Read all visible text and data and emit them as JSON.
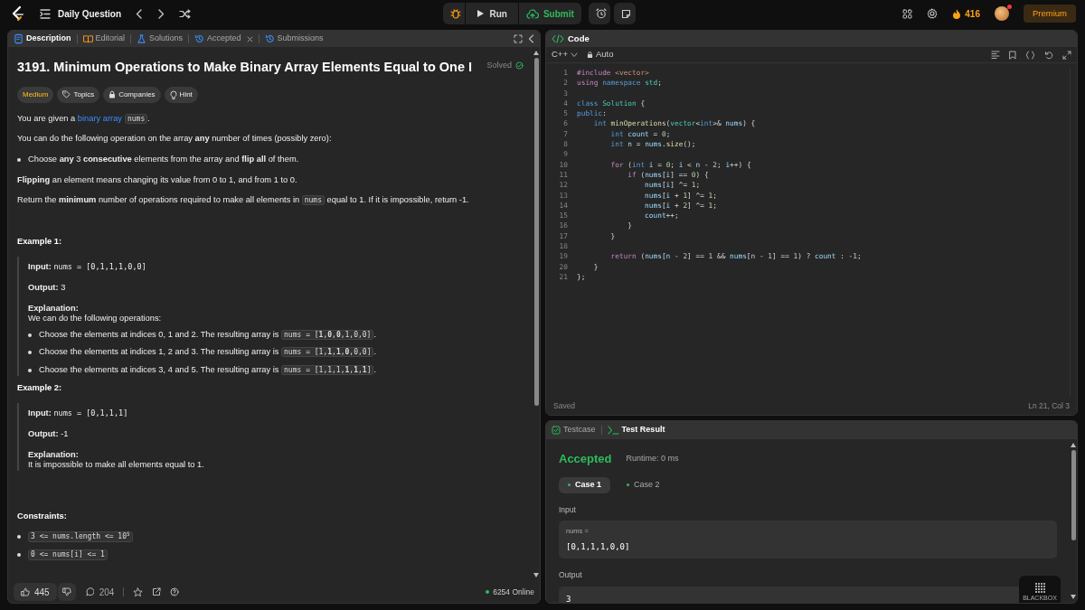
{
  "topbar": {
    "title": "Daily Question",
    "run": "Run",
    "submit": "Submit",
    "streak": "416",
    "premium": "Premium",
    "notification": true
  },
  "description_tabs": [
    {
      "label": "Description",
      "selected": true,
      "closable": false
    },
    {
      "label": "Editorial",
      "selected": false,
      "closable": false
    },
    {
      "label": "Solutions",
      "selected": false,
      "closable": false
    },
    {
      "label": "Accepted",
      "selected": false,
      "closable": true
    },
    {
      "label": "Submissions",
      "selected": false,
      "closable": false
    }
  ],
  "problem": {
    "title": "3191. Minimum Operations to Make Binary Array Elements Equal to One I",
    "status": "Solved",
    "tags": [
      {
        "label": "Medium",
        "kind": "difficulty"
      },
      {
        "label": "Topics",
        "kind": "topics"
      },
      {
        "label": "Companies",
        "kind": "companies"
      },
      {
        "label": "Hint",
        "kind": "hint"
      }
    ],
    "blocks": [
      {
        "kind": "para",
        "segments": [
          {
            "kind": "text",
            "text": "You are given a "
          },
          {
            "kind": "link",
            "text": "binary array"
          },
          {
            "kind": "code",
            "text": "nums"
          },
          {
            "kind": "text",
            "text": "."
          }
        ]
      },
      {
        "kind": "para",
        "segments": [
          {
            "kind": "text",
            "text": "You can do the following operation on the array **any** number of times (possibly zero):"
          }
        ]
      },
      {
        "kind": "bullet",
        "segments": [
          {
            "kind": "text",
            "text": "Choose **any** 3 **consecutive** elements from the array and **flip all** of them."
          }
        ]
      },
      {
        "kind": "para",
        "segments": [
          {
            "kind": "text",
            "text": "**Flipping** an element means changing its value from 0 to 1, and from 1 to 0."
          }
        ]
      },
      {
        "kind": "para",
        "segments": [
          {
            "kind": "text",
            "text": "Return the **minimum** number of operations required to make all elements in "
          },
          {
            "kind": "code",
            "text": "nums"
          },
          {
            "kind": "text",
            "text": " equal to 1. If it is impossible, return -1."
          }
        ]
      }
    ],
    "examples": [
      {
        "title": "Example 1:",
        "input_label": "Input:",
        "input": "nums = [0,1,1,1,0,0]",
        "output_label": "Output:",
        "output": "3",
        "explanation_label": "Explanation:",
        "explanation": "We can do the following operations:",
        "steps": [
          [
            {
              "kind": "text",
              "text": "Choose the elements at indices 0, 1 and 2. The resulting array is "
            },
            {
              "kind": "code",
              "text": "nums = [**1**,**0**,**0**,1,0,0]"
            },
            {
              "kind": "text",
              "text": "."
            }
          ],
          [
            {
              "kind": "text",
              "text": "Choose the elements at indices 1, 2 and 3. The resulting array is "
            },
            {
              "kind": "code",
              "text": "nums = [1,**1**,**1**,**0**,0,0]"
            },
            {
              "kind": "text",
              "text": "."
            }
          ],
          [
            {
              "kind": "text",
              "text": "Choose the elements at indices 3, 4 and 5. The resulting array is "
            },
            {
              "kind": "code",
              "text": "nums = [1,1,1,**1**,**1**,**1**]"
            },
            {
              "kind": "text",
              "text": "."
            }
          ]
        ]
      },
      {
        "title": "Example 2:",
        "input_label": "Input:",
        "input": "nums = [0,1,1,1]",
        "output_label": "Output:",
        "output": "-1",
        "explanation_label": "Explanation:",
        "explanation": "It is impossible to make all elements equal to 1."
      }
    ],
    "constraints_title": "Constraints:",
    "constraints": [
      "3 <= nums.length <= 10$^{5}$",
      "0 <= nums[i] <= 1"
    ]
  },
  "footer": {
    "likes": "445",
    "comments": "204",
    "online": "6254 Online"
  },
  "code_panel": {
    "title": "Code",
    "language": "C++",
    "mode": "Auto",
    "status": "Saved",
    "cursor": "Ln 21, Col 3",
    "lines": [
      {
        "number": "1",
        "tokens": [
          {
            "kind": "pp",
            "text": "#include "
          },
          {
            "kind": "str",
            "text": "<vector>"
          }
        ]
      },
      {
        "number": "2",
        "tokens": [
          {
            "kind": "kw",
            "text": "using "
          },
          {
            "kind": "ty",
            "text": "namespace "
          },
          {
            "kind": "cls",
            "text": "std"
          },
          {
            "kind": "p",
            "text": ";"
          }
        ]
      },
      {
        "number": "3"
      },
      {
        "number": "4",
        "tokens": [
          {
            "kind": "ty",
            "text": "class "
          },
          {
            "kind": "cls",
            "text": "Solution"
          },
          {
            "kind": "p",
            "text": " {"
          }
        ]
      },
      {
        "number": "5",
        "tokens": [
          {
            "kind": "ty",
            "text": "public"
          },
          {
            "kind": "p",
            "text": ":"
          }
        ]
      },
      {
        "number": "6",
        "tokens": [
          {
            "kind": "ty",
            "text": "    int "
          },
          {
            "kind": "fn",
            "text": "minOperations"
          },
          {
            "kind": "p",
            "text": "("
          },
          {
            "kind": "cls",
            "text": "vector"
          },
          {
            "kind": "p",
            "text": "<"
          },
          {
            "kind": "ty",
            "text": "int"
          },
          {
            "kind": "p",
            "text": ">& "
          },
          {
            "kind": "var",
            "text": "nums"
          },
          {
            "kind": "p",
            "text": ") {"
          }
        ]
      },
      {
        "number": "7",
        "tokens": [
          {
            "kind": "ty",
            "text": "        int "
          },
          {
            "kind": "var",
            "text": "count"
          },
          {
            "kind": "p",
            "text": " = "
          },
          {
            "kind": "num",
            "text": "0"
          },
          {
            "kind": "p",
            "text": ";"
          }
        ]
      },
      {
        "number": "8",
        "tokens": [
          {
            "kind": "ty",
            "text": "        int "
          },
          {
            "kind": "var",
            "text": "n"
          },
          {
            "kind": "p",
            "text": " = "
          },
          {
            "kind": "var",
            "text": "nums"
          },
          {
            "kind": "p",
            "text": "."
          },
          {
            "kind": "fn",
            "text": "size"
          },
          {
            "kind": "p",
            "text": "();"
          }
        ]
      },
      {
        "number": "9"
      },
      {
        "number": "10",
        "tokens": [
          {
            "kind": "kw",
            "text": "        for "
          },
          {
            "kind": "p",
            "text": "("
          },
          {
            "kind": "ty",
            "text": "int "
          },
          {
            "kind": "var",
            "text": "i"
          },
          {
            "kind": "p",
            "text": " = "
          },
          {
            "kind": "num",
            "text": "0"
          },
          {
            "kind": "p",
            "text": "; "
          },
          {
            "kind": "var",
            "text": "i"
          },
          {
            "kind": "p",
            "text": " < "
          },
          {
            "kind": "var",
            "text": "n"
          },
          {
            "kind": "p",
            "text": " - "
          },
          {
            "kind": "num",
            "text": "2"
          },
          {
            "kind": "p",
            "text": "; "
          },
          {
            "kind": "var",
            "text": "i"
          },
          {
            "kind": "p",
            "text": "++) {"
          }
        ]
      },
      {
        "number": "11",
        "tokens": [
          {
            "kind": "kw",
            "text": "            if "
          },
          {
            "kind": "p",
            "text": "("
          },
          {
            "kind": "var",
            "text": "nums"
          },
          {
            "kind": "p",
            "text": "["
          },
          {
            "kind": "var",
            "text": "i"
          },
          {
            "kind": "p",
            "text": "] == "
          },
          {
            "kind": "num",
            "text": "0"
          },
          {
            "kind": "p",
            "text": ") {"
          }
        ]
      },
      {
        "number": "12",
        "tokens": [
          {
            "kind": "var",
            "text": "                nums"
          },
          {
            "kind": "p",
            "text": "["
          },
          {
            "kind": "var",
            "text": "i"
          },
          {
            "kind": "p",
            "text": "] ^= "
          },
          {
            "kind": "num",
            "text": "1"
          },
          {
            "kind": "p",
            "text": ";"
          }
        ]
      },
      {
        "number": "13",
        "tokens": [
          {
            "kind": "var",
            "text": "                nums"
          },
          {
            "kind": "p",
            "text": "["
          },
          {
            "kind": "var",
            "text": "i"
          },
          {
            "kind": "p",
            "text": " + "
          },
          {
            "kind": "num",
            "text": "1"
          },
          {
            "kind": "p",
            "text": "] ^= "
          },
          {
            "kind": "num",
            "text": "1"
          },
          {
            "kind": "p",
            "text": ";"
          }
        ]
      },
      {
        "number": "14",
        "tokens": [
          {
            "kind": "var",
            "text": "                nums"
          },
          {
            "kind": "p",
            "text": "["
          },
          {
            "kind": "var",
            "text": "i"
          },
          {
            "kind": "p",
            "text": " + "
          },
          {
            "kind": "num",
            "text": "2"
          },
          {
            "kind": "p",
            "text": "] ^= "
          },
          {
            "kind": "num",
            "text": "1"
          },
          {
            "kind": "p",
            "text": ";"
          }
        ]
      },
      {
        "number": "15",
        "tokens": [
          {
            "kind": "var",
            "text": "                count"
          },
          {
            "kind": "p",
            "text": "++;"
          }
        ]
      },
      {
        "number": "16",
        "tokens": [
          {
            "kind": "p",
            "text": "            }"
          }
        ]
      },
      {
        "number": "17",
        "tokens": [
          {
            "kind": "p",
            "text": "        }"
          }
        ]
      },
      {
        "number": "18"
      },
      {
        "number": "19",
        "tokens": [
          {
            "kind": "kw",
            "text": "        return "
          },
          {
            "kind": "p",
            "text": "("
          },
          {
            "kind": "var",
            "text": "nums"
          },
          {
            "kind": "p",
            "text": "["
          },
          {
            "kind": "var",
            "text": "n"
          },
          {
            "kind": "p",
            "text": " - "
          },
          {
            "kind": "num",
            "text": "2"
          },
          {
            "kind": "p",
            "text": "] == "
          },
          {
            "kind": "num",
            "text": "1"
          },
          {
            "kind": "p",
            "text": " && "
          },
          {
            "kind": "var",
            "text": "nums"
          },
          {
            "kind": "p",
            "text": "["
          },
          {
            "kind": "var",
            "text": "n"
          },
          {
            "kind": "p",
            "text": " - "
          },
          {
            "kind": "num",
            "text": "1"
          },
          {
            "kind": "p",
            "text": "] == "
          },
          {
            "kind": "num",
            "text": "1"
          },
          {
            "kind": "p",
            "text": ") ? "
          },
          {
            "kind": "var",
            "text": "count"
          },
          {
            "kind": "p",
            "text": " : -"
          },
          {
            "kind": "num",
            "text": "1"
          },
          {
            "kind": "p",
            "text": ";"
          }
        ]
      },
      {
        "number": "20",
        "tokens": [
          {
            "kind": "p",
            "text": "    }"
          }
        ]
      },
      {
        "number": "21",
        "tokens": [
          {
            "kind": "p",
            "text": "};"
          }
        ]
      }
    ]
  },
  "result_panel": {
    "tabs": [
      {
        "label": "Testcase",
        "selected": false
      },
      {
        "label": "Test Result",
        "selected": true
      }
    ],
    "verdict": "Accepted",
    "runtime": "Runtime: 0 ms",
    "cases": [
      {
        "label": "Case 1",
        "selected": true
      },
      {
        "label": "Case 2",
        "selected": false
      }
    ],
    "input_label": "Input",
    "param": "nums =",
    "input": "[0,1,1,1,0,0]",
    "output_label": "Output",
    "output": "3",
    "widget": "BLACKBOX"
  }
}
